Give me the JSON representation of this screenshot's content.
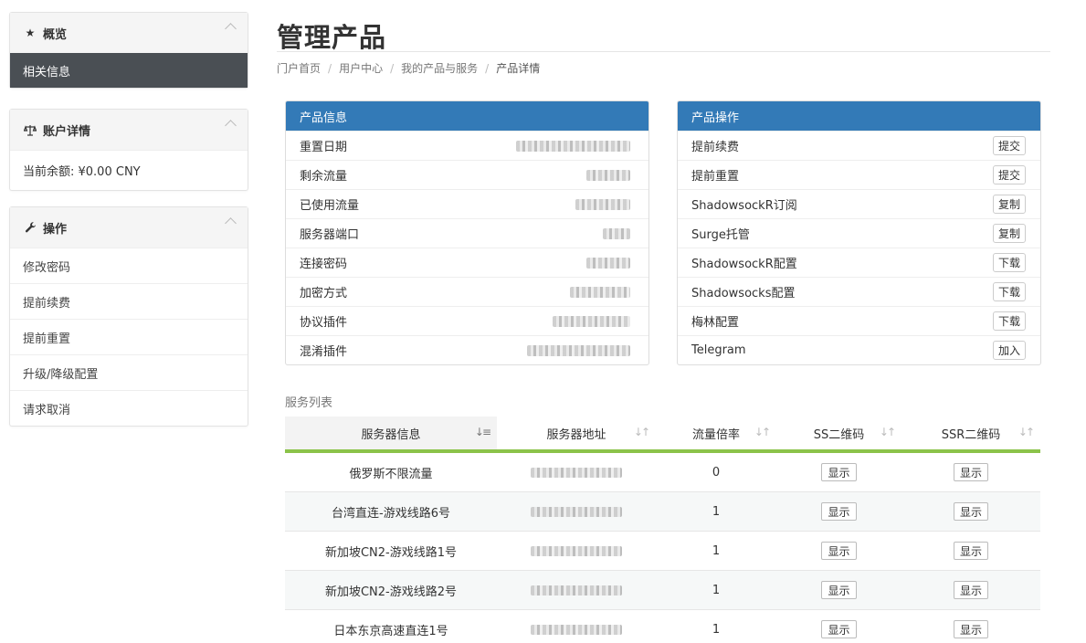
{
  "sidebar": {
    "overview": {
      "title": "概览",
      "items": [
        "相关信息"
      ]
    },
    "account": {
      "title": "账户详情",
      "balance": "当前余额: ¥0.00 CNY"
    },
    "actions": {
      "title": "操作",
      "items": [
        "修改密码",
        "提前续费",
        "提前重置",
        "升级/降级配置",
        "请求取消"
      ]
    }
  },
  "header": {
    "title": "管理产品",
    "breadcrumb": [
      "门户首页",
      "用户中心",
      "我的产品与服务",
      "产品详情"
    ]
  },
  "product_info": {
    "title": "产品信息",
    "rows": [
      "重置日期",
      "剩余流量",
      "已使用流量",
      "服务器端口",
      "连接密码",
      "加密方式",
      "协议插件",
      "混淆插件"
    ]
  },
  "product_ops": {
    "title": "产品操作",
    "rows": [
      {
        "label": "提前续费",
        "button": "提交"
      },
      {
        "label": "提前重置",
        "button": "提交"
      },
      {
        "label": "ShadowsockR订阅",
        "button": "复制"
      },
      {
        "label": "Surge托管",
        "button": "复制"
      },
      {
        "label": "ShadowsockR配置",
        "button": "下载"
      },
      {
        "label": "Shadowsocks配置",
        "button": "下载"
      },
      {
        "label": "梅林配置",
        "button": "下载"
      },
      {
        "label": "Telegram",
        "button": "加入"
      }
    ]
  },
  "services": {
    "label": "服务列表",
    "columns": [
      "服务器信息",
      "服务器地址",
      "流量倍率",
      "SS二维码",
      "SSR二维码"
    ],
    "show_label": "显示",
    "rows": [
      {
        "name": "俄罗斯不限流量",
        "rate": "0"
      },
      {
        "name": "台湾直连-游戏线路6号",
        "rate": "1"
      },
      {
        "name": "新加坡CN2-游戏线路1号",
        "rate": "1"
      },
      {
        "name": "新加坡CN2-游戏线路2号",
        "rate": "1"
      },
      {
        "name": "日本东京高速直连1号",
        "rate": "1"
      }
    ]
  },
  "colors": {
    "primary": "#337ab7",
    "accent_green": "#8bc34a",
    "sidebar_active": "#4a4f54"
  }
}
